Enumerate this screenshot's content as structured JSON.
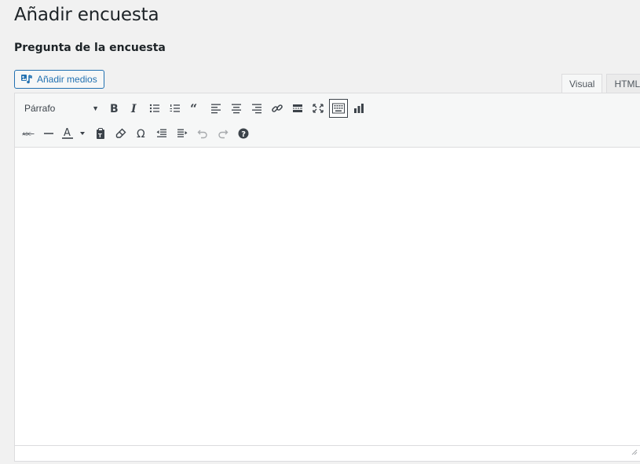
{
  "page": {
    "title": "Añadir encuesta"
  },
  "section": {
    "title": "Pregunta de la encuesta"
  },
  "media_button": {
    "label": "Añadir medios",
    "icon": "add-media-icon"
  },
  "tabs": [
    {
      "label": "Visual",
      "active": true
    },
    {
      "label": "HTML",
      "active": false
    }
  ],
  "toolbar": {
    "format_select": {
      "value": "Párrafo",
      "arrow": "▼"
    },
    "row1": [
      {
        "name": "bold",
        "icon": "bold-icon"
      },
      {
        "name": "italic",
        "icon": "italic-icon"
      },
      {
        "name": "bulleted-list",
        "icon": "bullet-list-icon"
      },
      {
        "name": "numbered-list",
        "icon": "numbered-list-icon"
      },
      {
        "name": "blockquote",
        "icon": "blockquote-icon"
      },
      {
        "name": "align-left",
        "icon": "align-left-icon"
      },
      {
        "name": "align-center",
        "icon": "align-center-icon"
      },
      {
        "name": "align-right",
        "icon": "align-right-icon"
      },
      {
        "name": "insert-link",
        "icon": "link-icon"
      },
      {
        "name": "insert-read-more",
        "icon": "read-more-icon"
      },
      {
        "name": "fullscreen",
        "icon": "fullscreen-icon"
      },
      {
        "name": "toolbar-toggle",
        "icon": "keyboard-icon",
        "pressed": true
      },
      {
        "name": "insert-poll",
        "icon": "bar-chart-icon"
      }
    ],
    "row2": [
      {
        "name": "strikethrough",
        "icon": "strikethrough-icon"
      },
      {
        "name": "horizontal-line",
        "icon": "horizontal-line-icon"
      },
      {
        "name": "text-color",
        "icon": "text-color-icon"
      },
      {
        "name": "paste-as-text",
        "icon": "paste-text-icon"
      },
      {
        "name": "clear-formatting",
        "icon": "eraser-icon"
      },
      {
        "name": "special-character",
        "icon": "omega-icon"
      },
      {
        "name": "outdent",
        "icon": "outdent-icon"
      },
      {
        "name": "indent",
        "icon": "indent-icon"
      },
      {
        "name": "undo",
        "icon": "undo-icon",
        "disabled": true
      },
      {
        "name": "redo",
        "icon": "redo-icon",
        "disabled": true
      },
      {
        "name": "keyboard-shortcuts",
        "icon": "help-icon"
      }
    ]
  },
  "colors": {
    "accent": "#2271b1",
    "icon": "#3c434a",
    "disabled": "#a7aaad",
    "border": "#dcdcde"
  }
}
